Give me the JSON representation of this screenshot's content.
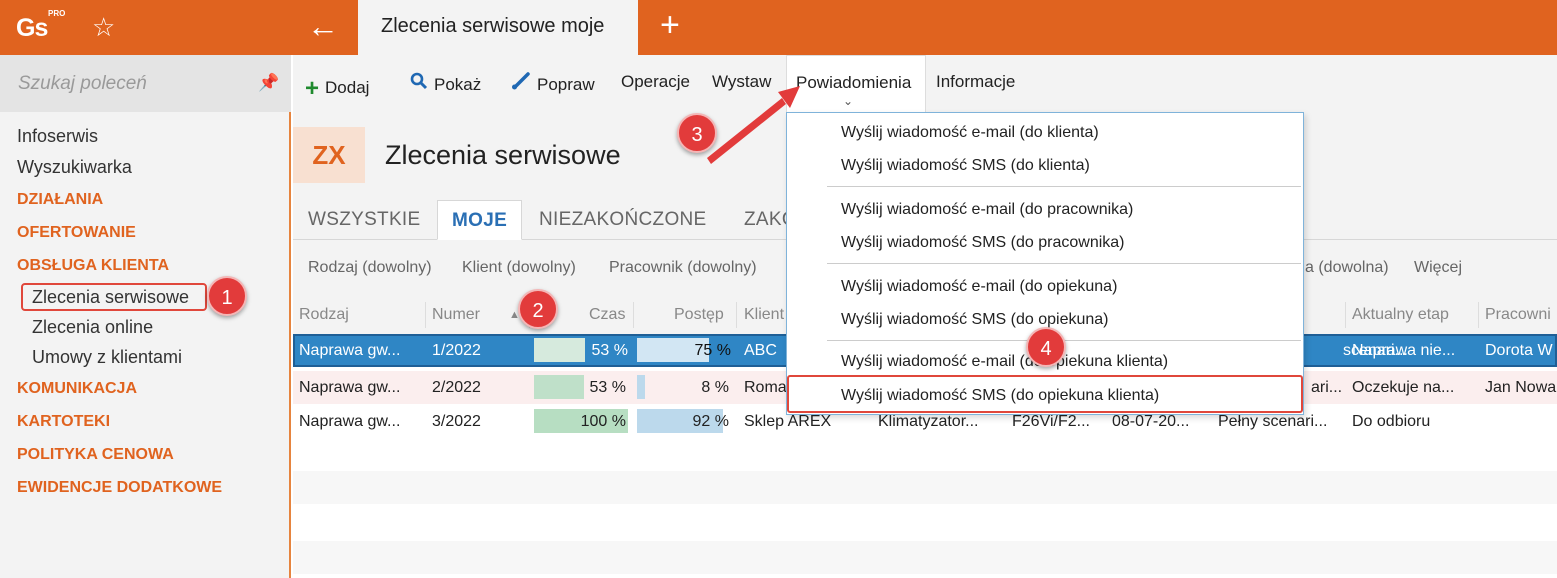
{
  "app": {
    "logo": "Gs",
    "logo_sup": "PRO",
    "active_tab": "Zlecenia serwisowe moje"
  },
  "sidebar": {
    "search_placeholder": "Szukaj poleceń",
    "items": [
      {
        "type": "item",
        "label": "Infoserwis"
      },
      {
        "type": "item",
        "label": "Wyszukiwarka"
      },
      {
        "type": "section",
        "label": "DZIAŁANIA"
      },
      {
        "type": "section",
        "label": "OFERTOWANIE"
      },
      {
        "type": "section",
        "label": "OBSŁUGA KLIENTA"
      },
      {
        "type": "sub",
        "label": "Zlecenia serwisowe",
        "selected": true
      },
      {
        "type": "sub",
        "label": "Zlecenia online"
      },
      {
        "type": "sub",
        "label": "Umowy z klientami"
      },
      {
        "type": "section",
        "label": "KOMUNIKACJA"
      },
      {
        "type": "section",
        "label": "KARTOTEKI"
      },
      {
        "type": "section",
        "label": "POLITYKA CENOWA"
      },
      {
        "type": "section",
        "label": "EWIDENCJE DODATKOWE"
      }
    ]
  },
  "toolbar": {
    "add": "Dodaj",
    "show": "Pokaż",
    "edit": "Popraw",
    "operations": "Operacje",
    "issue": "Wystaw",
    "notifications": "Powiadomienia",
    "info": "Informacje"
  },
  "header": {
    "badge": "ZX",
    "title": "Zlecenia serwisowe"
  },
  "tabs": [
    "WSZYSTKIE",
    "MOJE",
    "NIEZAKOŃCZONE",
    "ZAKO"
  ],
  "filters": {
    "type": "Rodzaj (dowolny)",
    "client": "Klient (dowolny)",
    "employee": "Pracownik (dowolny)",
    "date": "a (dowolna)",
    "more": "Więcej"
  },
  "grid": {
    "headers": [
      "Rodzaj",
      "Numer",
      "Czas",
      "Postęp",
      "Klient",
      "Aktualny etap",
      "Pracowni"
    ],
    "rows": [
      {
        "type": "Naprawa gw...",
        "number": "1/2022",
        "time_pct": 53,
        "time": "53 %",
        "progress_pct": 75,
        "progress": "75 %",
        "client": "ABC",
        "device": "",
        "model": "",
        "date": "",
        "scenario": "scenari...",
        "stage": "Naprawa nie...",
        "employee": "Dorota W"
      },
      {
        "type": "Naprawa gw...",
        "number": "2/2022",
        "time_pct": 53,
        "time": "53 %",
        "progress_pct": 8,
        "progress": "8 %",
        "client": "Roma",
        "device": "",
        "model": "",
        "date": "",
        "scenario": "ari...",
        "stage": "Oczekuje na...",
        "employee": "Jan Nowa"
      },
      {
        "type": "Naprawa gw...",
        "number": "3/2022",
        "time_pct": 100,
        "time": "100 %",
        "progress_pct": 92,
        "progress": "92 %",
        "client": "Sklep AREX",
        "device": "Klimatyzator...",
        "model": "F26Vi/F2...",
        "date": "08-07-20...",
        "scenario": "Pełny scenari...",
        "stage": "Do odbioru",
        "employee": ""
      }
    ]
  },
  "menu": {
    "items": [
      "Wyślij wiadomość e-mail (do klienta)",
      "Wyślij wiadomość SMS (do klienta)",
      "Wyślij wiadomość e-mail (do pracownika)",
      "Wyślij wiadomość SMS (do pracownika)",
      "Wyślij wiadomość e-mail (do opiekuna)",
      "Wyślij wiadomość SMS (do opiekuna)",
      "Wyślij wiadomość e-mail (do opiekuna klienta)",
      "Wyślij wiadomość SMS (do opiekuna klienta)"
    ]
  },
  "annotations": [
    "1",
    "2",
    "3",
    "4"
  ],
  "colors": {
    "accent": "#e0631f",
    "selection": "#2f86c5",
    "callout": "#e23b3b"
  }
}
